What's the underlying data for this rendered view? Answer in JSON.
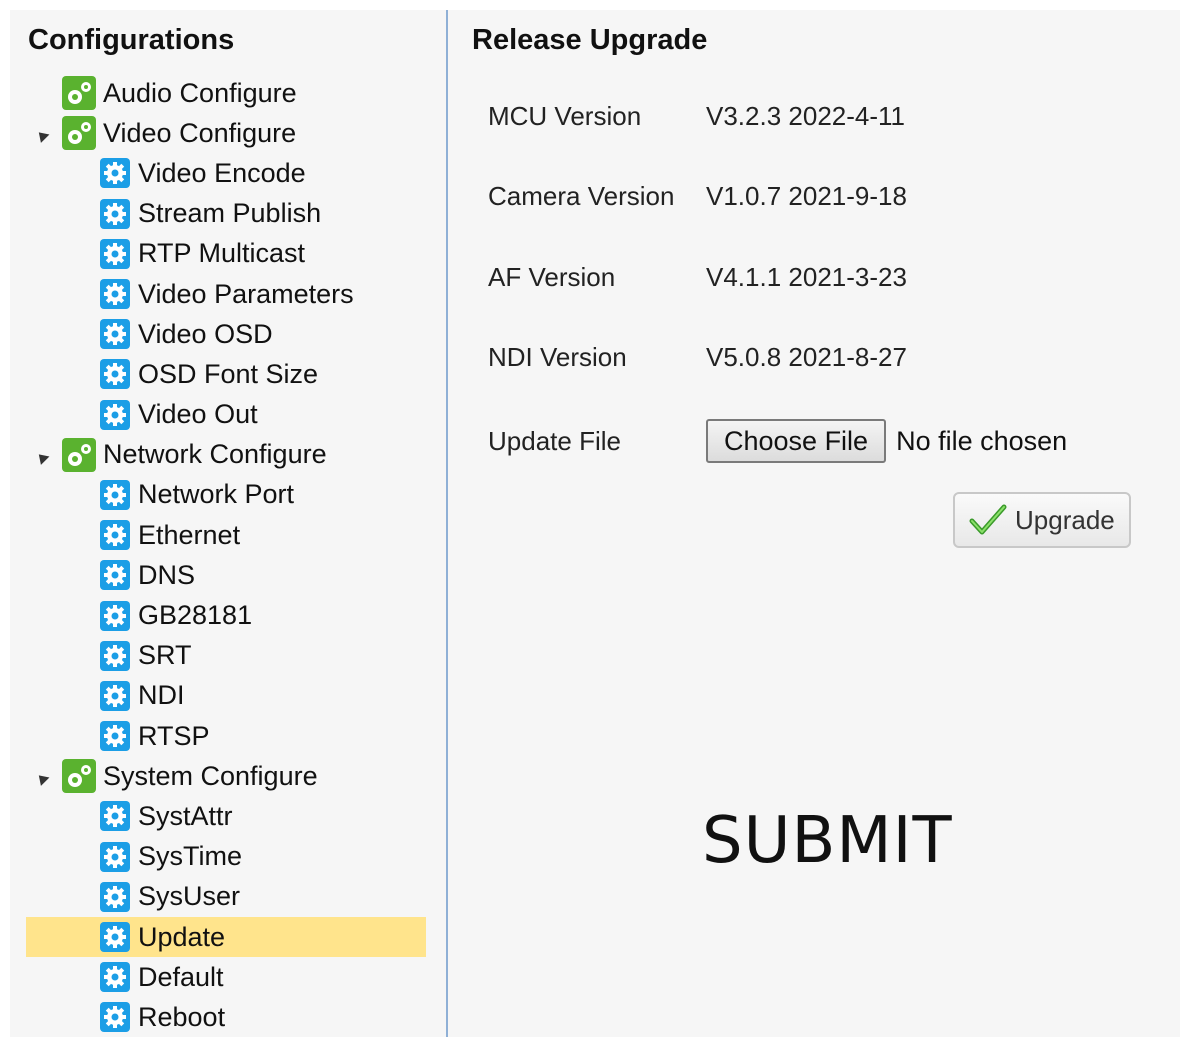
{
  "sidebar": {
    "title": "Configurations",
    "groups": [
      {
        "label": "Audio Configure",
        "expanded": false,
        "items": []
      },
      {
        "label": "Video Configure",
        "expanded": true,
        "items": [
          "Video Encode",
          "Stream Publish",
          "RTP Multicast",
          "Video Parameters",
          "Video OSD",
          "OSD Font Size",
          "Video Out"
        ]
      },
      {
        "label": "Network Configure",
        "expanded": true,
        "items": [
          "Network Port",
          "Ethernet",
          "DNS",
          "GB28181",
          "SRT",
          "NDI",
          "RTSP"
        ]
      },
      {
        "label": "System Configure",
        "expanded": true,
        "items": [
          "SystAttr",
          "SysTime",
          "SysUser",
          "Update",
          "Default",
          "Reboot"
        ]
      }
    ],
    "selected": "Update"
  },
  "main": {
    "title": "Release Upgrade",
    "versions": [
      {
        "key": "MCU Version",
        "value": "V3.2.3 2022-4-11"
      },
      {
        "key": "Camera Version",
        "value": "V1.0.7 2021-9-18"
      },
      {
        "key": "AF Version",
        "value": "V4.1.1 2021-3-23"
      },
      {
        "key": "NDI Version",
        "value": "V5.0.8 2021-8-27"
      }
    ],
    "update_file": {
      "label": "Update File",
      "button_label": "Choose File",
      "status": "No file chosen"
    },
    "upgrade_label": "Upgrade",
    "submit_label": "SUBMIT"
  },
  "colors": {
    "selected_bg": "#ffe48c",
    "group_icon": "#5ab22f",
    "item_icon": "#1c9ee6",
    "divider": "#8fb0d6"
  },
  "icons": {
    "group": "gears-icon",
    "item": "gear-icon",
    "upgrade": "checkmark-icon"
  }
}
